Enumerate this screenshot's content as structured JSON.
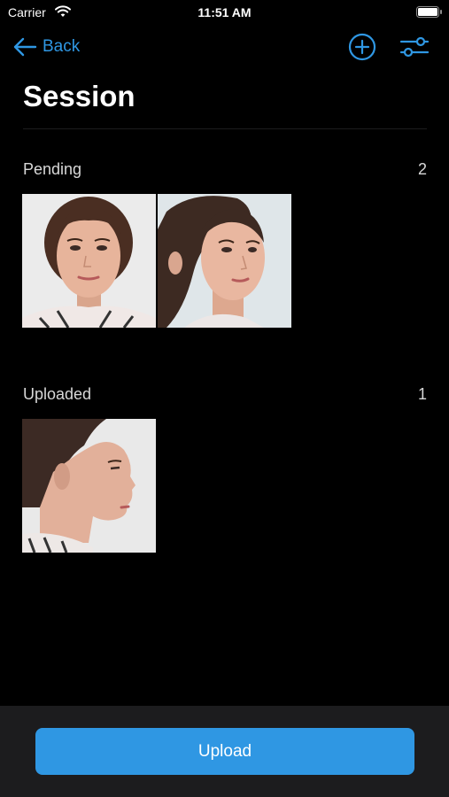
{
  "status_bar": {
    "carrier": "Carrier",
    "time": "11:51 AM",
    "wifi_icon": "wifi-icon",
    "battery_icon": "battery-icon"
  },
  "nav": {
    "back_label": "Back",
    "back_icon": "arrow-left-icon",
    "add_icon": "plus-circle-icon",
    "filter_icon": "sliders-icon"
  },
  "title": "Session",
  "sections": [
    {
      "label": "Pending",
      "count": "2",
      "photos": [
        {
          "view": "frontal face photo"
        },
        {
          "view": "three-quarter face photo"
        }
      ]
    },
    {
      "label": "Uploaded",
      "count": "1",
      "photos": [
        {
          "view": "profile face photo"
        }
      ]
    }
  ],
  "bottom": {
    "upload_label": "Upload"
  },
  "colors": {
    "accent": "#2f97e3",
    "background": "#000000",
    "bottom_bar": "#1c1c1e"
  }
}
